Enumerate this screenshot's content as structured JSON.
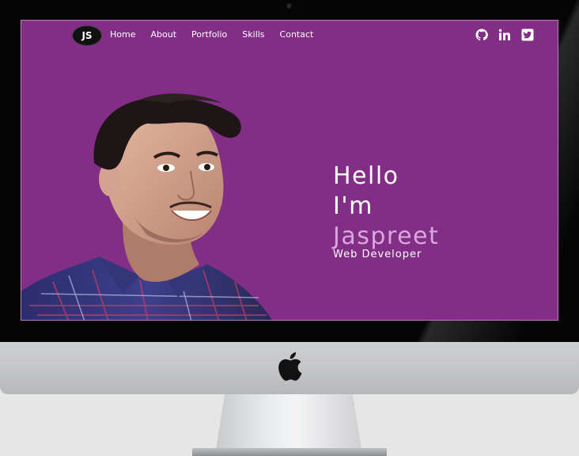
{
  "site": {
    "logo_text": "JS",
    "nav": [
      "Home",
      "About",
      "Portfolio",
      "Skills",
      "Contact"
    ],
    "socials": [
      "github-icon",
      "linkedin-icon",
      "twitter-icon"
    ]
  },
  "hero": {
    "line1": "Hello",
    "line2": "I'm",
    "name": "Jaspreet",
    "role": "Web Developer"
  },
  "colors": {
    "screen_bg": "#822e86",
    "name_accent": "#d9a7db"
  }
}
